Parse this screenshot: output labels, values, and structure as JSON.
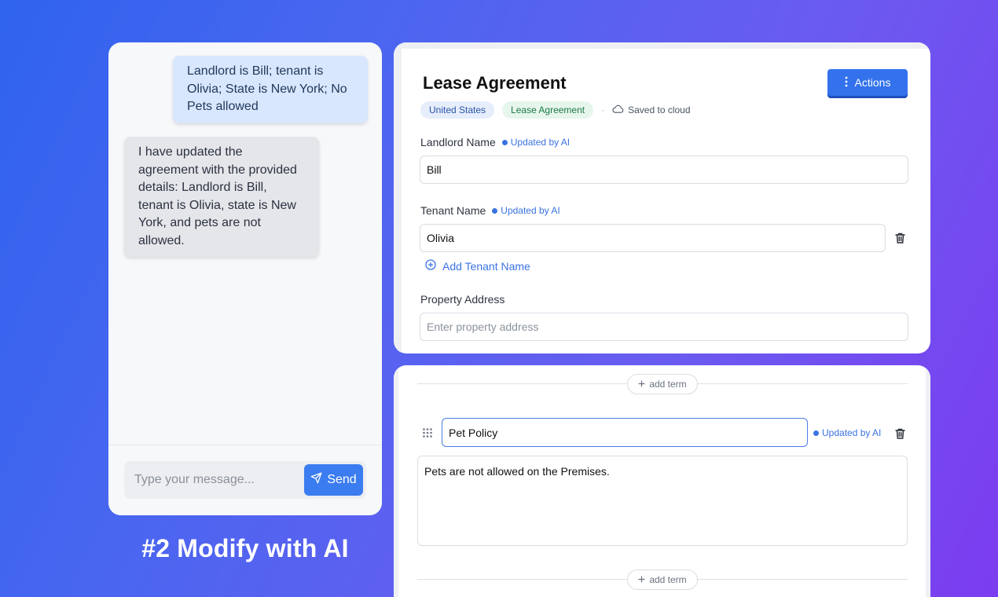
{
  "chat": {
    "user_message": "Landlord is Bill; tenant is Olivia; State is New York; No Pets allowed",
    "ai_message": "I have updated the agreement with the provided details: Landlord is Bill, tenant is Olivia, state is New York, and pets are not allowed.",
    "input_placeholder": "Type your message...",
    "send_label": "Send"
  },
  "caption": "#2 Modify with AI",
  "document": {
    "title": "Lease Agreement",
    "actions_label": "Actions",
    "country_chip": "United States",
    "type_chip": "Lease Agreement",
    "separator": "·",
    "saved_status": "Saved to cloud",
    "ai_tag": "Updated by AI",
    "fields": {
      "landlord": {
        "label": "Landlord Name",
        "value": "Bill"
      },
      "tenant": {
        "label": "Tenant Name",
        "value": "Olivia"
      },
      "add_tenant_label": "Add Tenant Name",
      "property": {
        "label": "Property Address",
        "placeholder": "Enter property address"
      }
    }
  },
  "terms": {
    "add_term_label": "add term",
    "term": {
      "title": "Pet Policy",
      "body": "Pets are not allowed on the Premises."
    }
  },
  "colors": {
    "accent": "#3b7cf0",
    "ai_blue": "#3a73e2",
    "user_bubble": "#d8e7fd",
    "ai_bubble": "#e4e6ea"
  },
  "icons": [
    "send-icon",
    "vertical-dots-icon",
    "cloud-icon",
    "trash-icon",
    "plus-circle-icon",
    "plus-icon",
    "drag-handle-icon"
  ]
}
